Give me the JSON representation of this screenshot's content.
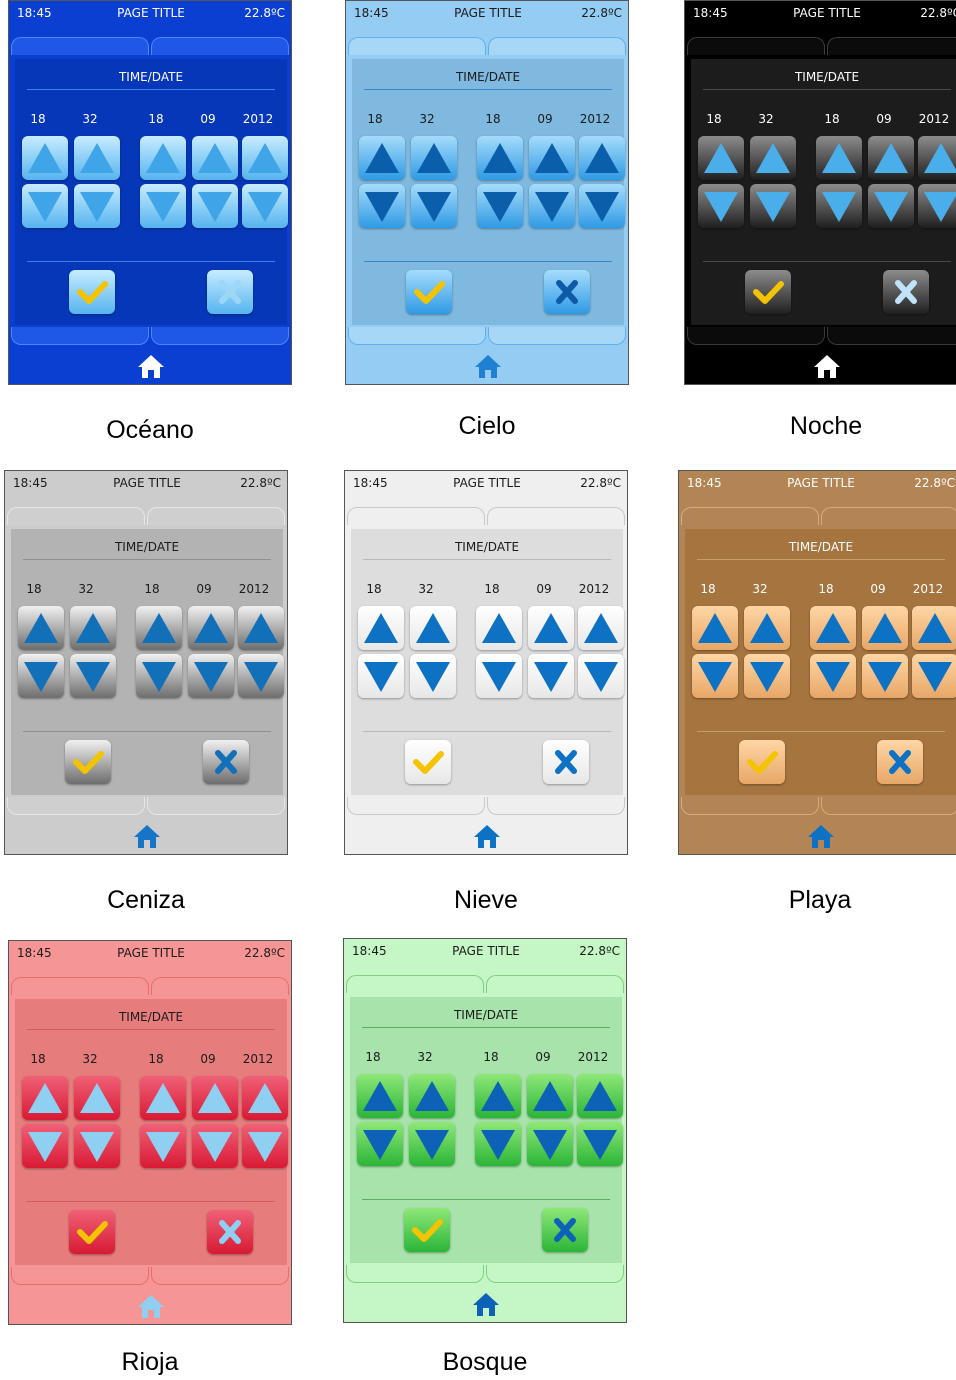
{
  "device_screen": {
    "time": "18:45",
    "page_title": "PAGE TITLE",
    "temperature": "22.8ºC",
    "dialog_title": "TIME/DATE",
    "values": [
      "18",
      "32",
      "18",
      "09",
      "2012"
    ]
  },
  "themes": [
    {
      "id": "oceano",
      "label": "Océano",
      "colors": {
        "bg": "#0a3fd1",
        "status_text": "#ffffff",
        "tab": "#1f57e6",
        "tab_border": "#4f86ff",
        "dialog": "#0537b8",
        "rule": "#3f7fe6",
        "text": "#ffffff",
        "btn_top": "#c7ecff",
        "btn_bot": "#55b4ef",
        "arrow": "#3fa4e8",
        "ok": "#f5c400",
        "cancel": "#9ed6f7",
        "home": "#ffffff",
        "home_bg": "#3a98f0"
      }
    },
    {
      "id": "cielo",
      "label": "Cielo",
      "colors": {
        "bg": "#94ccf4",
        "status_text": "#1b1b1b",
        "tab": "#a6d7f7",
        "tab_border": "#5fb0ea",
        "dialog": "#7fb9df",
        "rule": "#3a86c8",
        "text": "#1b1b1b",
        "btn_top": "#a5dcfb",
        "btn_bot": "#2f9ae5",
        "arrow": "#0b5ea9",
        "ok": "#f5c400",
        "cancel": "#0e5aa8",
        "home": "#1f7fd1",
        "home_bg": "none"
      }
    },
    {
      "id": "noche",
      "label": "Noche",
      "colors": {
        "bg": "#000000",
        "status_text": "#ffffff",
        "tab": "#0b0b0b",
        "tab_border": "#3a3a3a",
        "dialog": "#1c1c1c",
        "rule": "#4a4a4a",
        "text": "#ffffff",
        "btn_top": "#8c8c8c",
        "btn_bot": "#1f1f1f",
        "arrow": "#49aee9",
        "ok": "#f5c400",
        "cancel": "#bfe3f8",
        "home": "#ffffff",
        "home_bg": "none"
      }
    },
    {
      "id": "ceniza",
      "label": "Ceniza",
      "colors": {
        "bg": "#cccccc",
        "status_text": "#1b1b1b",
        "tab": "#cfcfcf",
        "tab_border": "#e6e6e6",
        "dialog": "#b3b3b3",
        "rule": "#8f8f8f",
        "text": "#1b1b1b",
        "btn_top": "#f0f0f0",
        "btn_bot": "#6d6d6d",
        "arrow": "#1170b8",
        "ok": "#f5c400",
        "cancel": "#1170b8",
        "home": "#1775c8",
        "home_bg": "none"
      }
    },
    {
      "id": "nieve",
      "label": "Nieve",
      "colors": {
        "bg": "#efefef",
        "status_text": "#1b1b1b",
        "tab": "#efefef",
        "tab_border": "#c9c9c9",
        "dialog": "#dddddd",
        "rule": "#b9b9b9",
        "text": "#1b1b1b",
        "btn_top": "#ffffff",
        "btn_bot": "#e7e7e7",
        "arrow": "#0d72c4",
        "ok": "#f5c400",
        "cancel": "#0d72c4",
        "home": "#0d72c4",
        "home_bg": "none"
      }
    },
    {
      "id": "playa",
      "label": "Playa",
      "colors": {
        "bg": "#b48554",
        "status_text": "#ffffff",
        "tab": "#b48554",
        "tab_border": "#d6ac7a",
        "dialog": "#a5743f",
        "rule": "#c89d6a",
        "text": "#ffffff",
        "btn_top": "#ffd6a6",
        "btn_bot": "#e7a767",
        "arrow": "#0d72c4",
        "ok": "#f5c400",
        "cancel": "#0d72c4",
        "home": "#0d72c4",
        "home_bg": "none"
      }
    },
    {
      "id": "rioja",
      "label": "Rioja",
      "colors": {
        "bg": "#f69595",
        "status_text": "#1b1b1b",
        "tab": "#f69595",
        "tab_border": "#e86e6e",
        "dialog": "#e77c7c",
        "rule": "#d25c5c",
        "text": "#1b1b1b",
        "btn_top": "#f06077",
        "btn_bot": "#d81a34",
        "arrow": "#8fd0f2",
        "ok": "#f5c400",
        "cancel": "#8fd0f2",
        "home": "#8fd0f2",
        "home_bg": "none"
      }
    },
    {
      "id": "bosque",
      "label": "Bosque",
      "colors": {
        "bg": "#c4f6c6",
        "status_text": "#1b1b1b",
        "tab": "#c4f6c6",
        "tab_border": "#7fcf86",
        "dialog": "#a8e3ab",
        "rule": "#5eae63",
        "text": "#1b1b1b",
        "btn_top": "#8ee878",
        "btn_bot": "#2bb537",
        "arrow": "#0d62b8",
        "ok": "#f5c400",
        "cancel": "#0d62b8",
        "home": "#0d62b8",
        "home_bg": "none"
      }
    }
  ]
}
